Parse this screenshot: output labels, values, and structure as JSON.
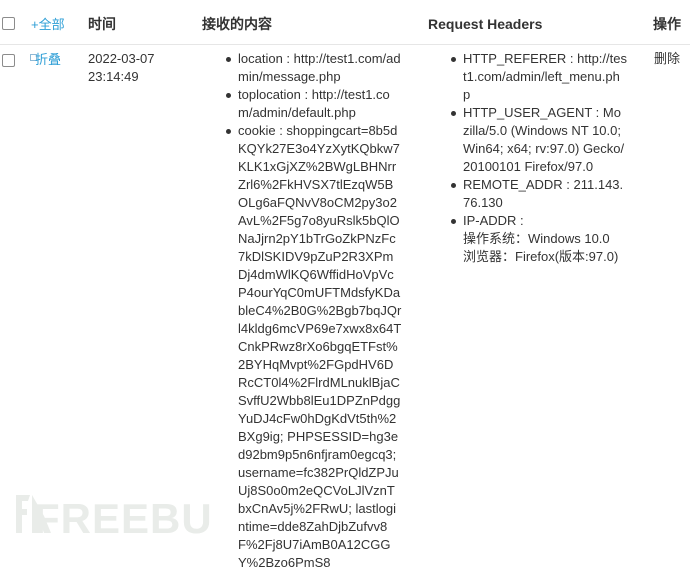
{
  "header": {
    "add_all": "+全部",
    "time": "时间",
    "content": "接收的内容",
    "request_headers": "Request Headers",
    "actions": "操作"
  },
  "row": {
    "collapse_label": "折叠",
    "date": "2022-03-07",
    "time": "23:14:49",
    "content_items": [
      "location : http://test1.com/admin/message.php",
      "toplocation : http://test1.com/admin/default.php",
      "cookie : shoppingcart=8b5dKQYk27E3o4YzXytKQbkw7KLK1xGjXZ%2BWgLBHNrrZrl6%2FkHVSX7tlEzqW5BOLg6aFQNvV8oCM2py3o2AvL%2F5g7o8yuRslk5bQlONaJjrn2pY1bTrGoZkPNzFc7kDlSKIDV9pZuP2R3XPmDj4dmWlKQ6WffidHoVpVcP4ourYqC0mUFTMdsfyKDableC4%2B0G%2Bgb7bqJQrl4kldg6mcVP69e7xwx8x64TCnkPRwz8rXo6bgqETFst%2BYHqMvpt%2FGpdHV6DRcCT0l4%2FlrdMLnuklBjaCSvffU2Wbb8lEu1DPZnPdggYuDJ4cFw0hDgKdVt5th%2BXg9ig; PHPSESSID=hg3ed92bm9p5n6nfjram0egcq3; username=fc382PrQldZPJuUj8S0o0m2eQCVoLJlVznTbxCnAv5j%2FRwU; lastlogintime=dde8ZahDjbZufvv8F%2Fj8U7iAmB0A12CGGY%2Bzo6PmS8"
    ],
    "headers": [
      {
        "text": "HTTP_REFERER : http://test1.com/admin/left_menu.php"
      },
      {
        "text": "HTTP_USER_AGENT : Mozilla/5.0 (Windows NT 10.0; Win64; x64; rv:97.0) Gecko/20100101 Firefox/97.0"
      },
      {
        "text": "REMOTE_ADDR : 211.143.76.130"
      },
      {
        "text": "IP-ADDR :",
        "os": "操作系统：Windows 10.0",
        "browser": "浏览器：Firefox(版本:97.0)"
      }
    ],
    "delete_label": "删除"
  },
  "watermark": {
    "text": "FREEBUF"
  },
  "colors": {
    "link": "#2d9ed6",
    "border": "#e6e6e6",
    "text": "#333333"
  }
}
